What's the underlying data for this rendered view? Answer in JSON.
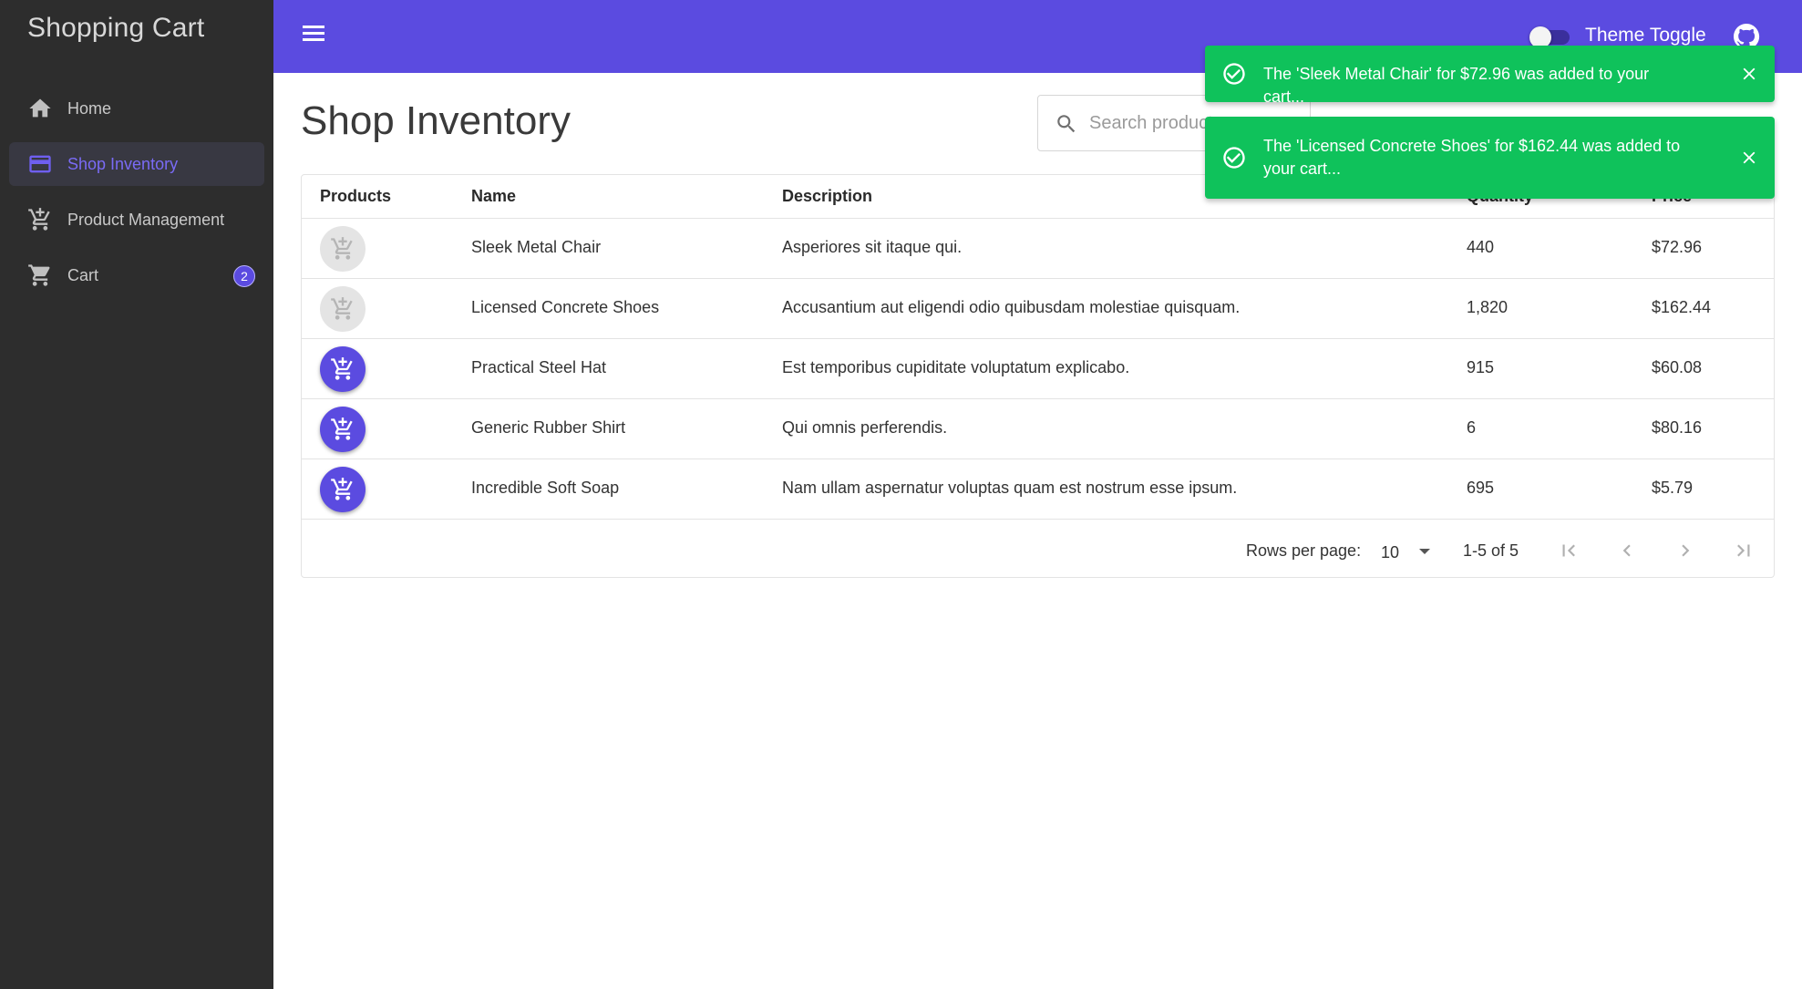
{
  "app": {
    "title": "Shopping Cart"
  },
  "sidebar": {
    "items": [
      {
        "label": "Home",
        "icon": "home-icon"
      },
      {
        "label": "Shop Inventory",
        "icon": "credit-card-icon",
        "active": true
      },
      {
        "label": "Product Management",
        "icon": "add-shopping-cart-icon"
      },
      {
        "label": "Cart",
        "icon": "shopping-cart-icon",
        "badge": "2"
      }
    ]
  },
  "topbar": {
    "theme_toggle_label": "Theme Toggle",
    "theme_toggle_on": false
  },
  "page": {
    "title": "Shop Inventory"
  },
  "search": {
    "placeholder": "Search products"
  },
  "table": {
    "headers": [
      "Products",
      "Name",
      "Description",
      "Quantity",
      "Price"
    ],
    "rows": [
      {
        "name": "Sleek Metal Chair",
        "description": "Asperiores sit itaque qui.",
        "quantity": "440",
        "price": "$72.96",
        "in_cart": true
      },
      {
        "name": "Licensed Concrete Shoes",
        "description": "Accusantium aut eligendi odio quibusdam molestiae quisquam.",
        "quantity": "1,820",
        "price": "$162.44",
        "in_cart": true
      },
      {
        "name": "Practical Steel Hat",
        "description": "Est temporibus cupiditate voluptatum explicabo.",
        "quantity": "915",
        "price": "$60.08",
        "in_cart": false
      },
      {
        "name": "Generic Rubber Shirt",
        "description": "Qui omnis perferendis.",
        "quantity": "6",
        "price": "$80.16",
        "in_cart": false
      },
      {
        "name": "Incredible Soft Soap",
        "description": "Nam ullam aspernatur voluptas quam est nostrum esse ipsum.",
        "quantity": "695",
        "price": "$5.79",
        "in_cart": false
      }
    ]
  },
  "pagination": {
    "rows_per_page_label": "Rows per page:",
    "rows_per_page": "10",
    "range": "1-5 of 5"
  },
  "toasts": [
    {
      "message": "The 'Sleek Metal Chair' for $72.96 was added to your cart..."
    },
    {
      "message": "The 'Licensed Concrete Shoes' for $162.44 was added to your cart..."
    }
  ],
  "colors": {
    "primary": "#5b4be0",
    "sidebar": "#2d2d2d",
    "success": "#0fc25b"
  }
}
